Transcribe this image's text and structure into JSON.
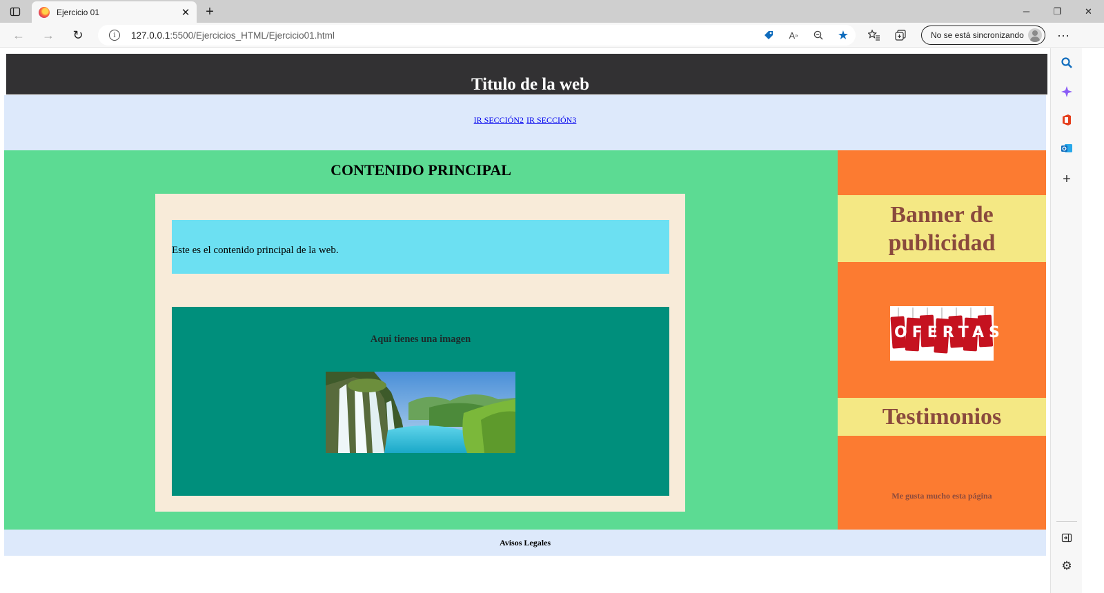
{
  "browser": {
    "tab_title": "Ejercicio 01",
    "url_host": "127.0.0.1",
    "url_path": ":5500/Ejercicios_HTML/Ejercicio01.html",
    "sync_label": "No se está sincronizando",
    "accent_color": "#0f6cbd"
  },
  "page": {
    "header_title": "Titulo de la web",
    "nav_links": [
      "IR SECCIÓN2",
      "IR SECCIÓN3"
    ],
    "main_heading": "CONTENIDO PRINCIPAL",
    "main_text": "Este es el contenido principal de la web.",
    "figure_heading": "Aqui tienes una imagen",
    "banner_heading": "Banner de publicidad",
    "ofertas_text": "OFERTAS",
    "testimonials_heading": "Testimonios",
    "testimonial_text": "Me gusta mucho esta página",
    "footer_text": "Avisos Legales",
    "colors": {
      "header_bg": "#323133",
      "nav_bg": "#dde9fb",
      "main_bg": "#5cdb93",
      "article_bg": "#f8ebd9",
      "textbox_bg": "#6ce0f2",
      "figure_bg": "#008f7c",
      "aside_bg": "#fc7b31",
      "highlight_bg": "#f4e884",
      "aside_text": "#8a4a3d"
    }
  }
}
